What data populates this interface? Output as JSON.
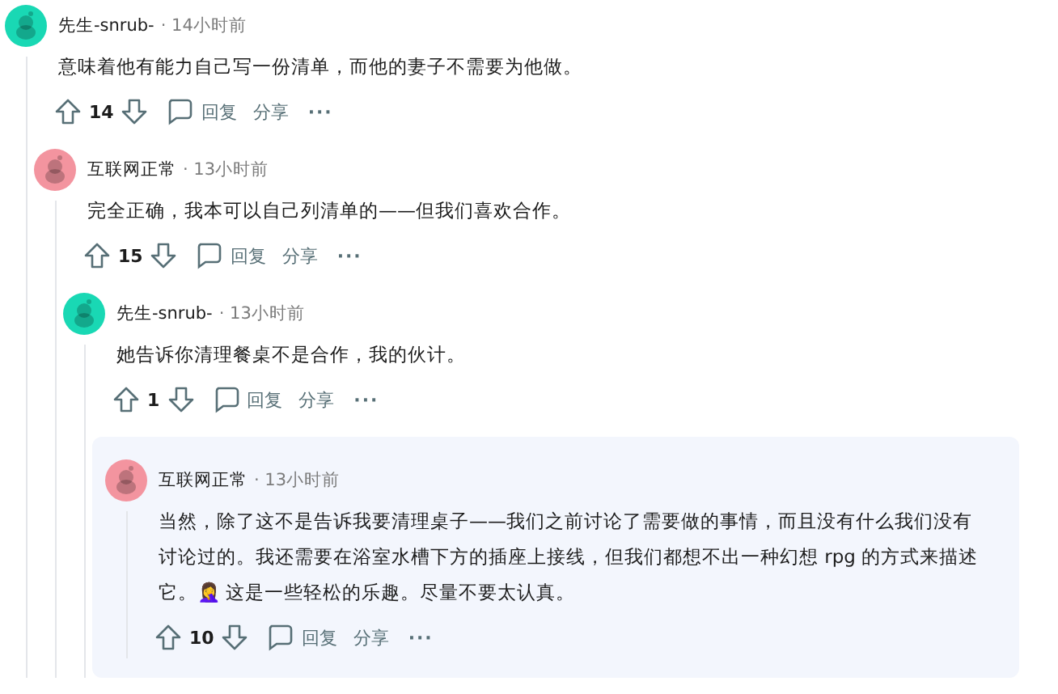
{
  "comments": [
    {
      "author": "先生-snrub-",
      "time": "· 14小时前",
      "body": "意味着他有能力自己写一份清单，而他的妻子不需要为他做。",
      "votes": "14",
      "reply": "回复",
      "share": "分享",
      "more": "···",
      "color": "#19d8b4",
      "highlighted": false,
      "children": [
        {
          "author": "互联网正常",
          "time": "· 13小时前",
          "body": "完全正确，我本可以自己列清单的——但我们喜欢合作。",
          "votes": "15",
          "reply": "回复",
          "share": "分享",
          "more": "···",
          "color": "#f3949f",
          "highlighted": false,
          "children": [
            {
              "author": "先生-snrub-",
              "time": "· 13小时前",
              "body": "她告诉你清理餐桌不是合作，我的伙计。",
              "votes": "1",
              "reply": "回复",
              "share": "分享",
              "more": "···",
              "color": "#19d8b4",
              "highlighted": false,
              "children": [
                {
                  "author": "互联网正常",
                  "time": "· 13小时前",
                  "body": "当然，除了这不是告诉我要清理桌子——我们之前讨论了需要做的事情，而且没有什么我们没有讨论过的。我还需要在浴室水槽下方的插座上接线，但我们都想不出一种幻想 rpg 的方式来描述它。🤦‍♀️ 这是一些轻松的乐趣。尽量不要太认真。",
                  "votes": "10",
                  "reply": "回复",
                  "share": "分享",
                  "more": "···",
                  "color": "#f3949f",
                  "highlighted": true
                }
              ]
            }
          ]
        }
      ]
    }
  ]
}
